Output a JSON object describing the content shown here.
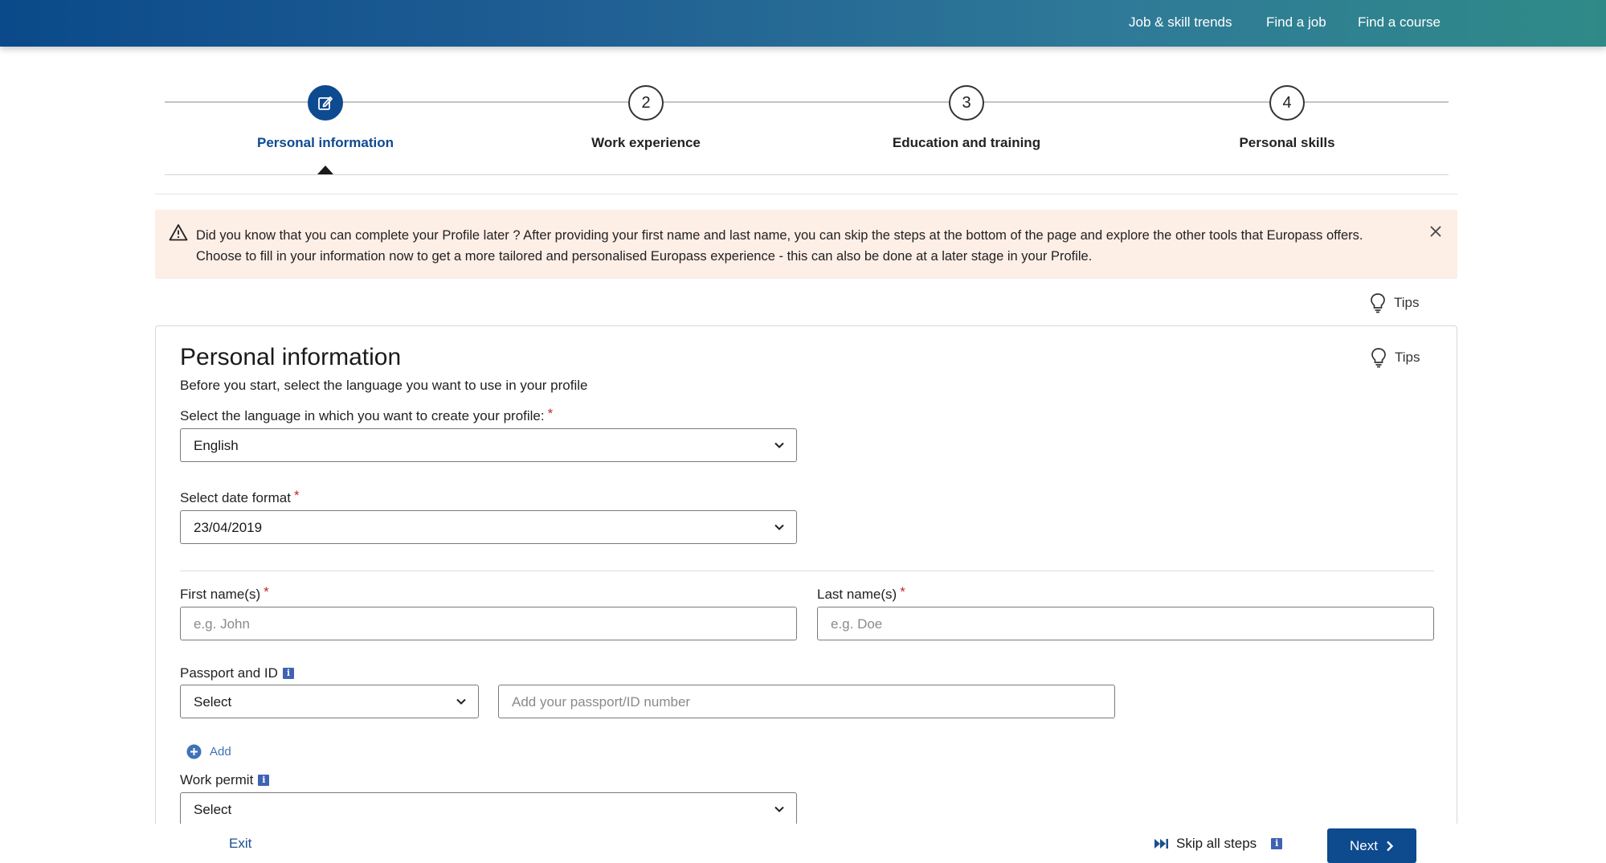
{
  "top_nav": [
    "Job & skill trends",
    "Find a job",
    "Find a course"
  ],
  "steps": [
    {
      "number": "",
      "label": "Personal information",
      "active": true
    },
    {
      "number": "2",
      "label": "Work experience",
      "active": false
    },
    {
      "number": "3",
      "label": "Education and training",
      "active": false
    },
    {
      "number": "4",
      "label": "Personal skills",
      "active": false
    }
  ],
  "alert": {
    "text": "Did you know that you can complete your Profile later ? After providing your first name and last name, you can skip the steps at the bottom of the page and explore the other tools that Europass offers. Choose to fill in your information now to get a more tailored and personalised Europass experience - this can also be done at a later stage in your Profile."
  },
  "tips_label": "Tips",
  "form": {
    "title": "Personal information",
    "subtitle": "Before you start, select the language you want to use in your profile",
    "language_label": "Select the language in which you want to create your profile:",
    "language_value": "English",
    "date_format_label": "Select date format",
    "date_format_value": "23/04/2019",
    "first_name_label": "First name(s)",
    "first_name_placeholder": "e.g. John",
    "last_name_label": "Last name(s)",
    "last_name_placeholder": "e.g. Doe",
    "passport_label": "Passport and ID",
    "passport_select_value": "Select",
    "passport_number_placeholder": "Add your passport/ID number",
    "add_label": "Add",
    "work_permit_label": "Work permit",
    "work_permit_value": "Select",
    "required_mark": "*",
    "info_mark": "i"
  },
  "footer": {
    "exit_label": "Exit",
    "skip_label": "Skip all steps",
    "next_label": "Next"
  },
  "colors": {
    "primary": "#0d4a8e",
    "alert_bg": "#fdeee6",
    "required": "#c0282d"
  }
}
